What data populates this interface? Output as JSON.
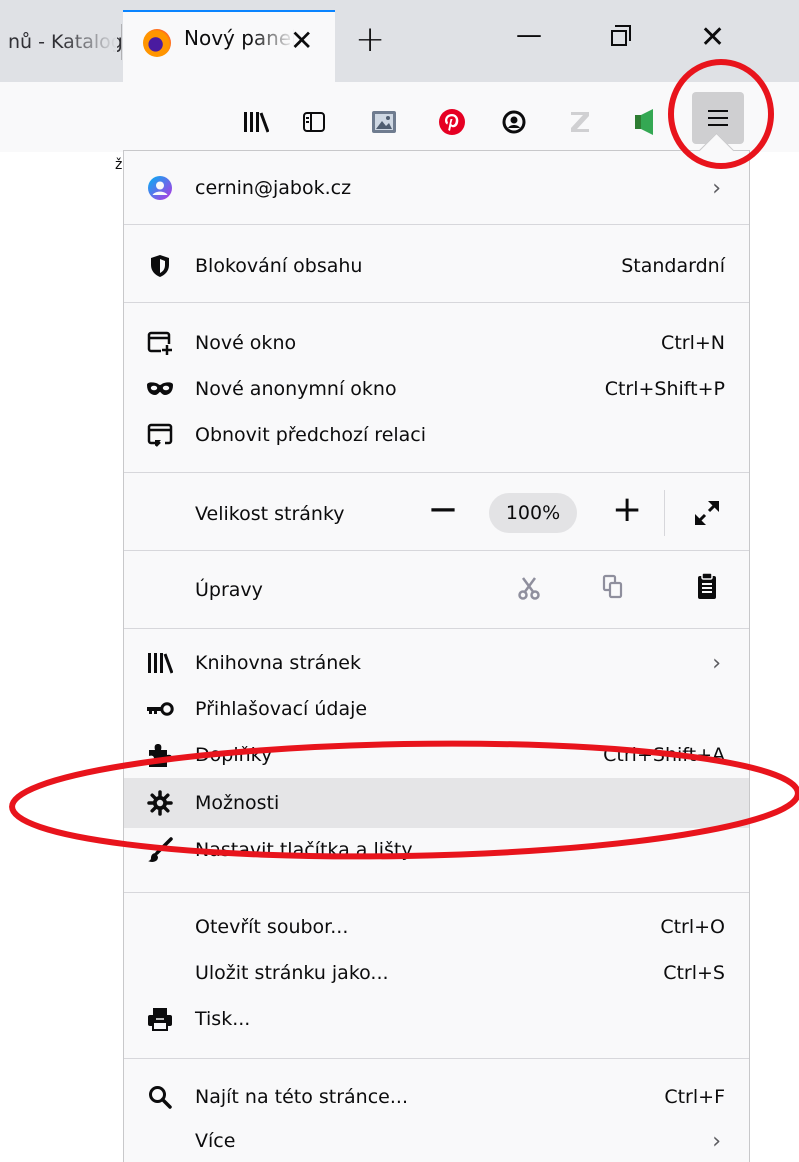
{
  "tabs": {
    "previous_title": "nů - Katalog",
    "active_title": "Nový panel",
    "close_symbol": "✕",
    "new_tab_symbol": "+"
  },
  "window": {
    "minimize": "—",
    "close": "✕"
  },
  "toolbar": {
    "icons": [
      "library-icon",
      "sidebar-icon",
      "screenshot-icon",
      "pinterest-icon",
      "account-icon",
      "zotero-icon",
      "extension-icon",
      "menu-icon"
    ]
  },
  "page": {
    "fragment": "ž"
  },
  "menu": {
    "account": {
      "email": "cernin@jabok.cz",
      "chevron": "›"
    },
    "content_blocking": {
      "label": "Blokování obsahu",
      "value": "Standardní"
    },
    "new_window": {
      "label": "Nové okno",
      "shortcut": "Ctrl+N"
    },
    "private_window": {
      "label": "Nové anonymní okno",
      "shortcut": "Ctrl+Shift+P"
    },
    "restore_session": {
      "label": "Obnovit předchozí relaci"
    },
    "zoom": {
      "label": "Velikost stránky",
      "minus": "—",
      "value": "100%",
      "plus": "+"
    },
    "edit": {
      "label": "Úpravy"
    },
    "library": {
      "label": "Knihovna stránek",
      "chevron": "›"
    },
    "logins": {
      "label": "Přihlašovací údaje"
    },
    "addons": {
      "label": "Doplňky",
      "shortcut": "Ctrl+Shift+A"
    },
    "options": {
      "label": "Možnosti"
    },
    "customize": {
      "label": "Nastavit tlačítka a lišty..."
    },
    "open_file": {
      "label": "Otevřít soubor...",
      "shortcut": "Ctrl+O"
    },
    "save_page": {
      "label": "Uložit stránku jako...",
      "shortcut": "Ctrl+S"
    },
    "print": {
      "label": "Tisk..."
    },
    "find": {
      "label": "Najít na této stránce...",
      "shortcut": "Ctrl+F"
    },
    "more": {
      "label": "Více",
      "chevron": "›"
    }
  },
  "annotation": {
    "color": "#e8141c"
  }
}
